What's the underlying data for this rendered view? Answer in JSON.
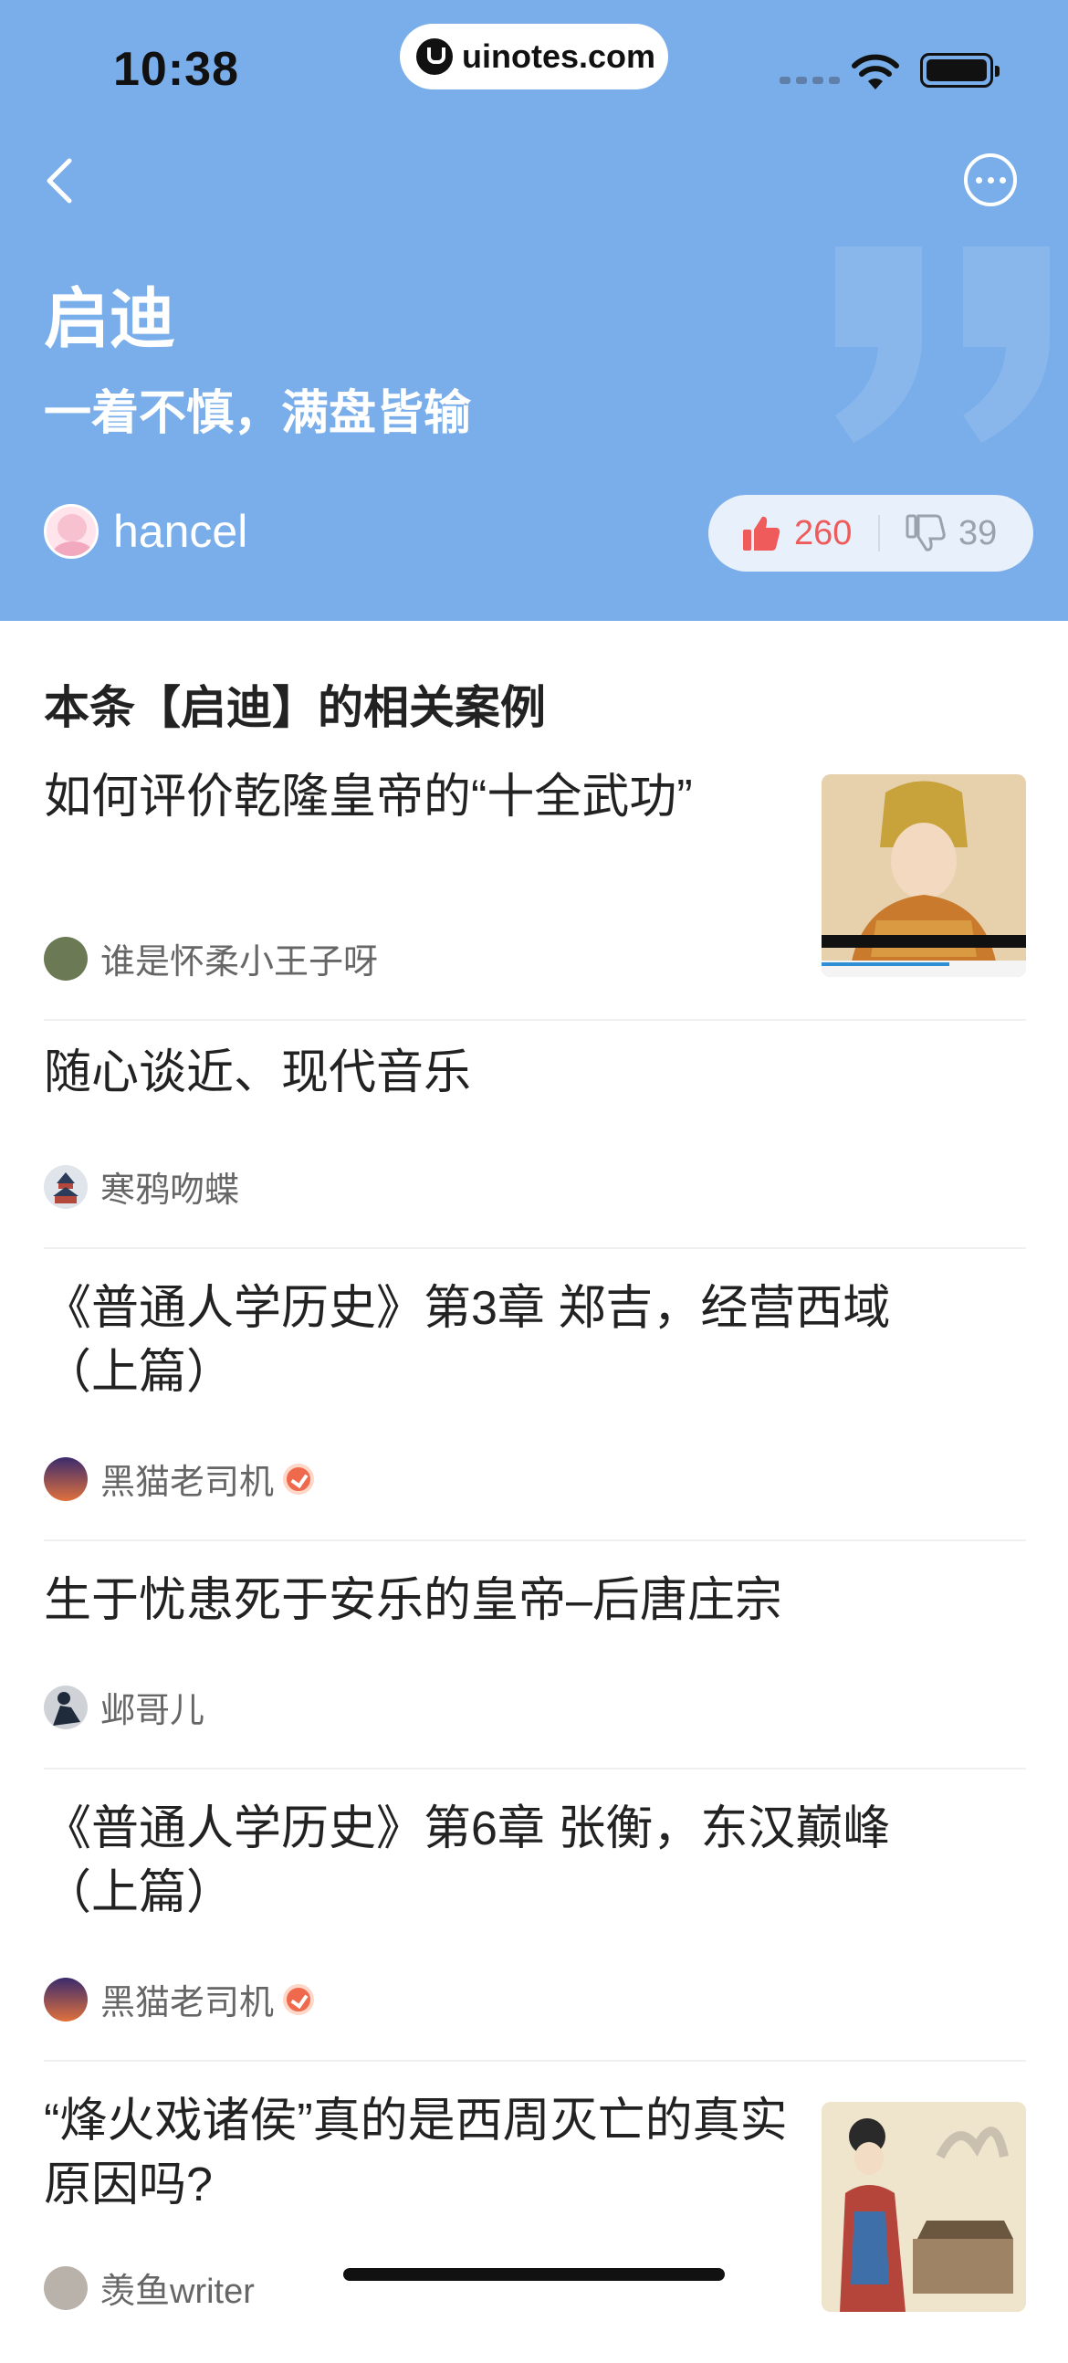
{
  "status_bar": {
    "time": "10:38",
    "url": "uinotes.com"
  },
  "header": {
    "title": "启迪",
    "subtitle": "一着不慎，满盘皆输",
    "author": "hancel",
    "likes": "260",
    "dislikes": "39",
    "accent_color": "#79aeea"
  },
  "section_title": "本条【启迪】的相关案例",
  "cases": [
    {
      "title": "如何评价乾隆皇帝的“十全武功”",
      "author": "谁是怀柔小王子呀",
      "verified": false,
      "has_thumbnail": true
    },
    {
      "title": "随心谈近、现代音乐",
      "author": "寒鸦吻蝶",
      "verified": false,
      "has_thumbnail": false
    },
    {
      "title": "《普通人学历史》第3章 郑吉，经营西域（上篇）",
      "author": "黑猫老司机",
      "verified": true,
      "has_thumbnail": false
    },
    {
      "title": "生于忧患死于安乐的皇帝–后唐庄宗",
      "author": "邺哥儿",
      "verified": false,
      "has_thumbnail": false
    },
    {
      "title": "《普通人学历史》第6章 张衡，东汉巅峰（上篇）",
      "author": "黑猫老司机",
      "verified": true,
      "has_thumbnail": false
    },
    {
      "title": "“烽火戏诸侯”真的是西周灭亡的真实原因吗?",
      "author": "羡鱼writer",
      "verified": false,
      "has_thumbnail": true
    }
  ],
  "icons": {
    "back": "chevron-left-icon",
    "more": "more-dots-icon",
    "like": "thumbs-up-icon",
    "dislike": "thumbs-down-icon",
    "verified": "verified-badge-icon"
  }
}
